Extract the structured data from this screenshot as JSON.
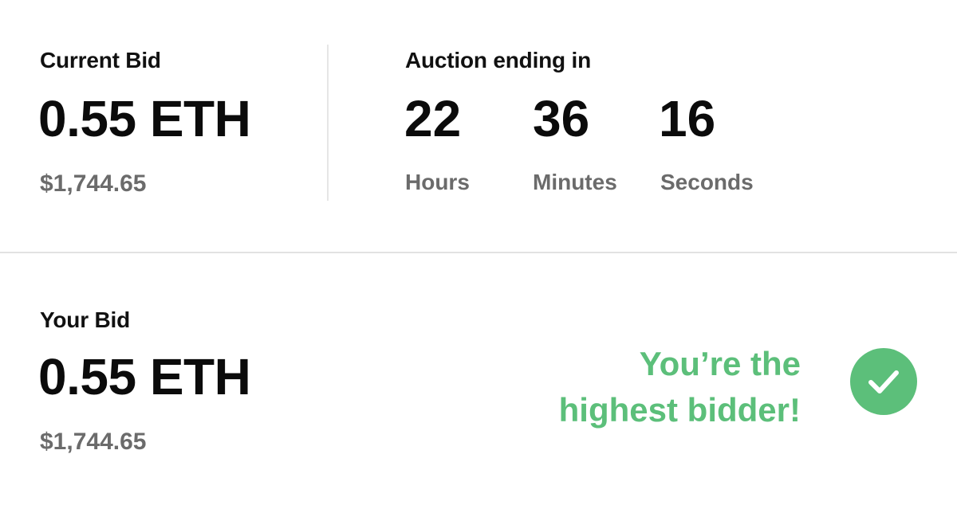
{
  "current_bid": {
    "label": "Current Bid",
    "amount": "0.55 ETH",
    "usd": "$1,744.65"
  },
  "auction": {
    "label": "Auction ending in",
    "hours": {
      "value": "22",
      "unit": "Hours"
    },
    "minutes": {
      "value": "36",
      "unit": "Minutes"
    },
    "seconds": {
      "value": "16",
      "unit": "Seconds"
    }
  },
  "your_bid": {
    "label": "Your Bid",
    "amount": "0.55 ETH",
    "usd": "$1,744.65",
    "status_line1": "You’re the",
    "status_line2": "highest bidder!",
    "status_icon": "checkmark-circle-icon"
  },
  "colors": {
    "success": "#5cbf7a",
    "muted": "#6b6b6b",
    "text": "#111111"
  }
}
